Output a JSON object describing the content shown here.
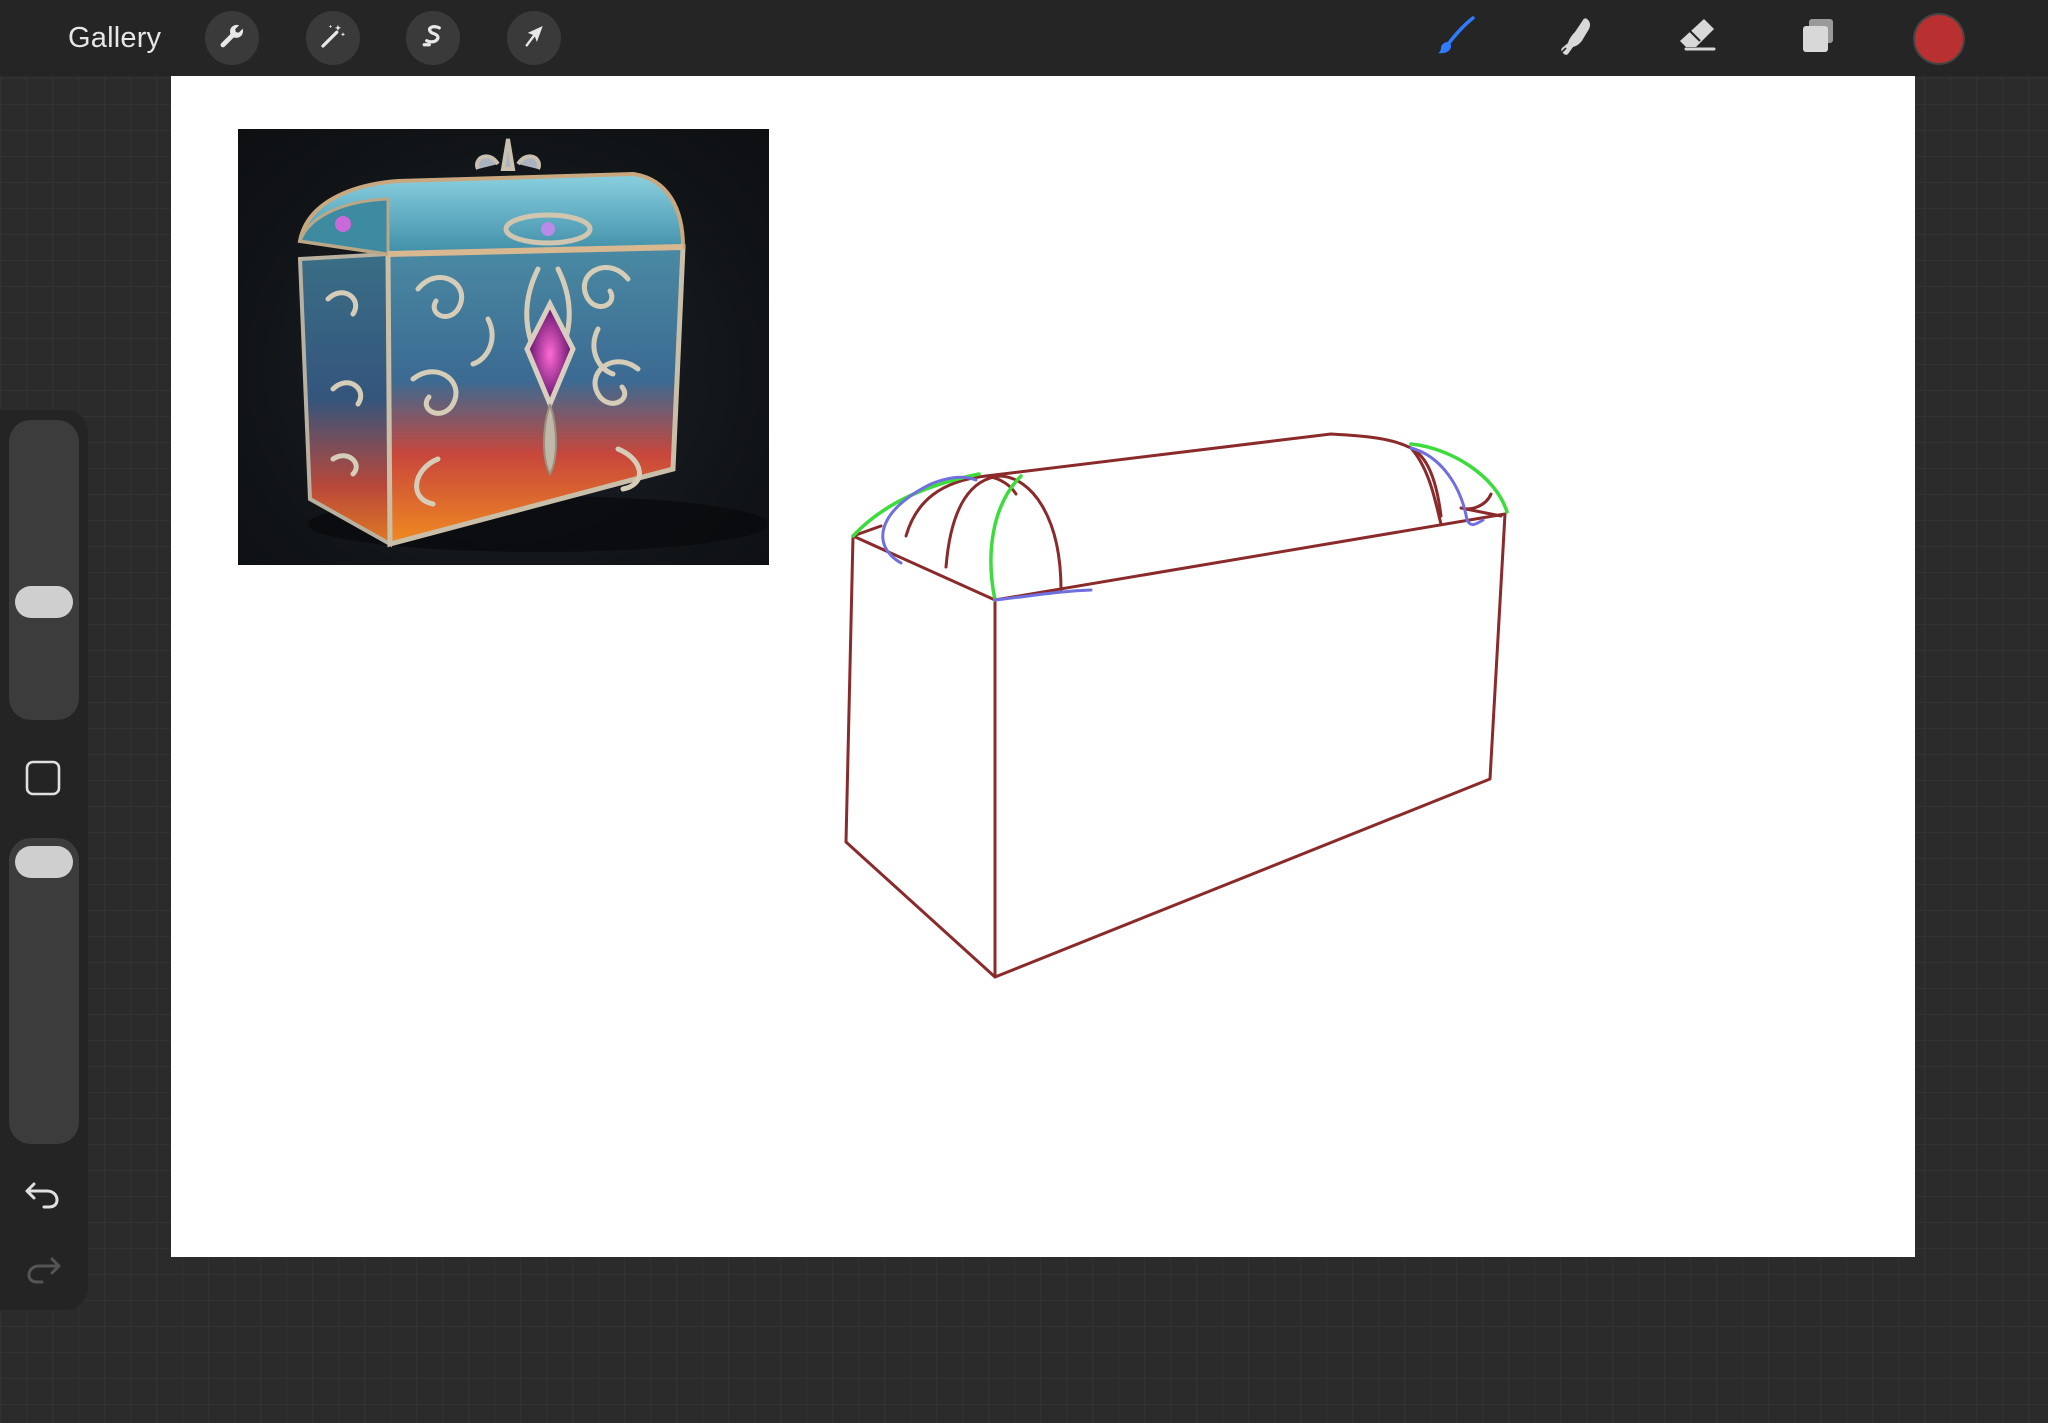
{
  "topbar": {
    "gallery_label": "Gallery",
    "left_tools": [
      {
        "name": "actions",
        "icon": "wrench-icon"
      },
      {
        "name": "adjustments",
        "icon": "magic-wand-icon"
      },
      {
        "name": "selection",
        "icon": "selection-s-icon"
      },
      {
        "name": "transform",
        "icon": "arrow-cursor-icon"
      }
    ],
    "right_tools": [
      {
        "name": "brush",
        "icon": "brush-icon",
        "active": true,
        "color": "#2f7bff"
      },
      {
        "name": "smudge",
        "icon": "smudge-finger-icon",
        "active": false
      },
      {
        "name": "eraser",
        "icon": "eraser-icon",
        "active": false
      },
      {
        "name": "layers",
        "icon": "layers-icon",
        "active": false
      }
    ],
    "current_color": "#b83030"
  },
  "sidebar": {
    "brush_size_level": 0.62,
    "opacity_level": 0.95,
    "modify_icon": "square-icon",
    "undo_icon": "undo-arrow-icon",
    "redo_icon": "redo-arrow-icon",
    "redo_enabled": false
  },
  "canvas": {
    "background": "#ffffff",
    "reference_image": "ornate-treasure-chest-reference",
    "sketch_colors": {
      "outline": "#8b2a2a",
      "green_guides": "#3ddc3d",
      "blue_guides": "#6f6fe0"
    }
  }
}
